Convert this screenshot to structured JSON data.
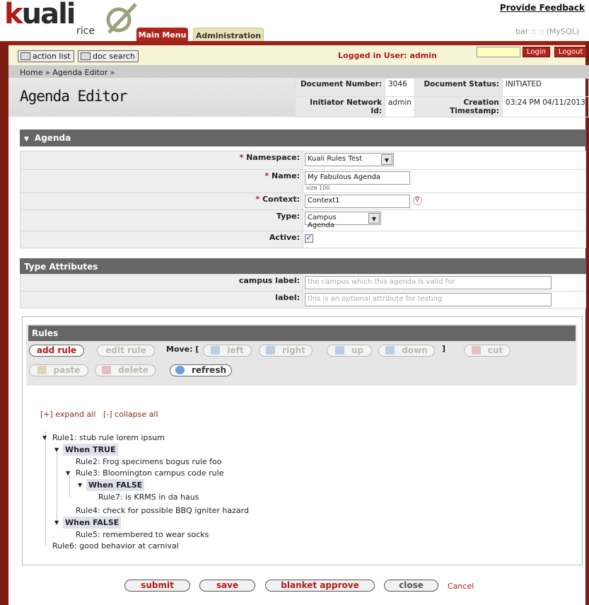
{
  "header": {
    "logo_k": "k",
    "logo_rest": "uali",
    "logo_sub": "rice",
    "feedback": "Provide Feedback",
    "db_info": "bar :: :: (MySQL)",
    "tabs": [
      {
        "label": "Main Menu"
      },
      {
        "label": "Administration"
      }
    ]
  },
  "userbar": {
    "action_list": "action list",
    "doc_search": "doc search",
    "logged_in": "Logged in User: admin",
    "login": "Login",
    "logout": "Logout"
  },
  "breadcrumb": "Home » Agenda Editor »",
  "page_title": "Agenda Editor",
  "docinfo": {
    "doc_number_label": "Document Number:",
    "doc_number": "3046",
    "doc_status_label": "Document Status:",
    "doc_status": "INITIATED",
    "initiator_label": "Initiator Network Id:",
    "initiator": "admin",
    "created_label": "Creation Timestamp:",
    "created": "03:24 PM 04/11/2013"
  },
  "agenda": {
    "section_title": "Agenda",
    "namespace_label": "Namespace:",
    "namespace_value": "Kuali Rules Test",
    "name_label": "Name:",
    "name_value": "My Fabulous Agenda",
    "name_hint": "size 100",
    "context_label": "Context:",
    "context_value": "Context1",
    "type_label": "Type:",
    "type_value": "Campus Agenda",
    "active_label": "Active:",
    "required_mark": "*"
  },
  "type_attributes": {
    "section_title": "Type Attributes",
    "campus_label": "campus label:",
    "campus_placeholder": "the campus which this agenda is valid for",
    "label_label": "label:",
    "label_placeholder": "this is an optional attribute for testing"
  },
  "rules": {
    "section_title": "Rules",
    "add_rule": "add rule",
    "edit_rule": "edit rule",
    "move_label": "Move: [",
    "move_close": "]",
    "left": "left",
    "right": "right",
    "up": "up",
    "down": "down",
    "cut": "cut",
    "paste": "paste",
    "delete": "delete",
    "refresh": "refresh",
    "expand_all": "[+] expand all",
    "collapse_all": "[-] collapse all",
    "tree": {
      "rule1": "Rule1: stub rule lorem ipsum",
      "when_true": "When TRUE",
      "rule2": "Rule2: Frog specimens bogus rule foo",
      "rule3": "Rule3: Bloomington campus code rule",
      "when_false_1": "When FALSE",
      "rule7": "Rule7: is KRMS in da haus",
      "rule4": "Rule4: check for possible BBQ igniter hazard",
      "when_false_2": "When FALSE",
      "rule5": "Rule5: remembered to wear socks",
      "rule6": "Rule6: good behavior at carnival"
    }
  },
  "footer": {
    "submit": "submit",
    "save": "save",
    "blanket_approve": "blanket approve",
    "close": "close",
    "cancel": "Cancel"
  },
  "colors": {
    "brand_red": "#b01a17",
    "header_gray": "#666666"
  }
}
